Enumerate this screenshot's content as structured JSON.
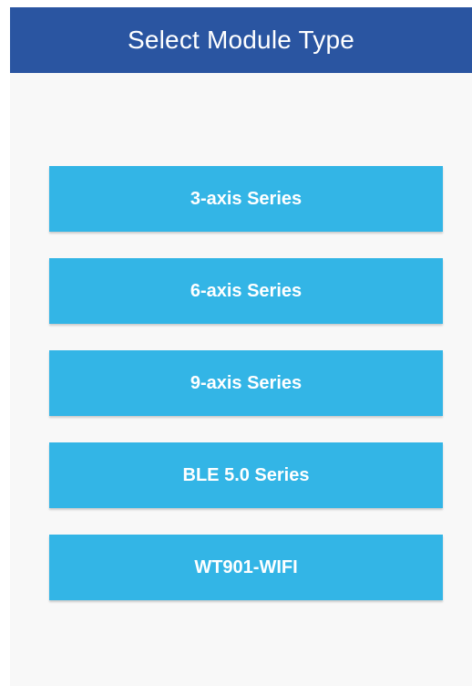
{
  "app_bar": {
    "title": "Select Module Type"
  },
  "colors": {
    "app_bar": "#2a55a1",
    "button": "#33b5e6",
    "background": "#f8f8f8",
    "text": "#ffffff"
  },
  "modules": [
    {
      "label": "3-axis Series"
    },
    {
      "label": "6-axis Series"
    },
    {
      "label": "9-axis Series"
    },
    {
      "label": "BLE 5.0 Series"
    },
    {
      "label": "WT901-WIFI"
    }
  ]
}
